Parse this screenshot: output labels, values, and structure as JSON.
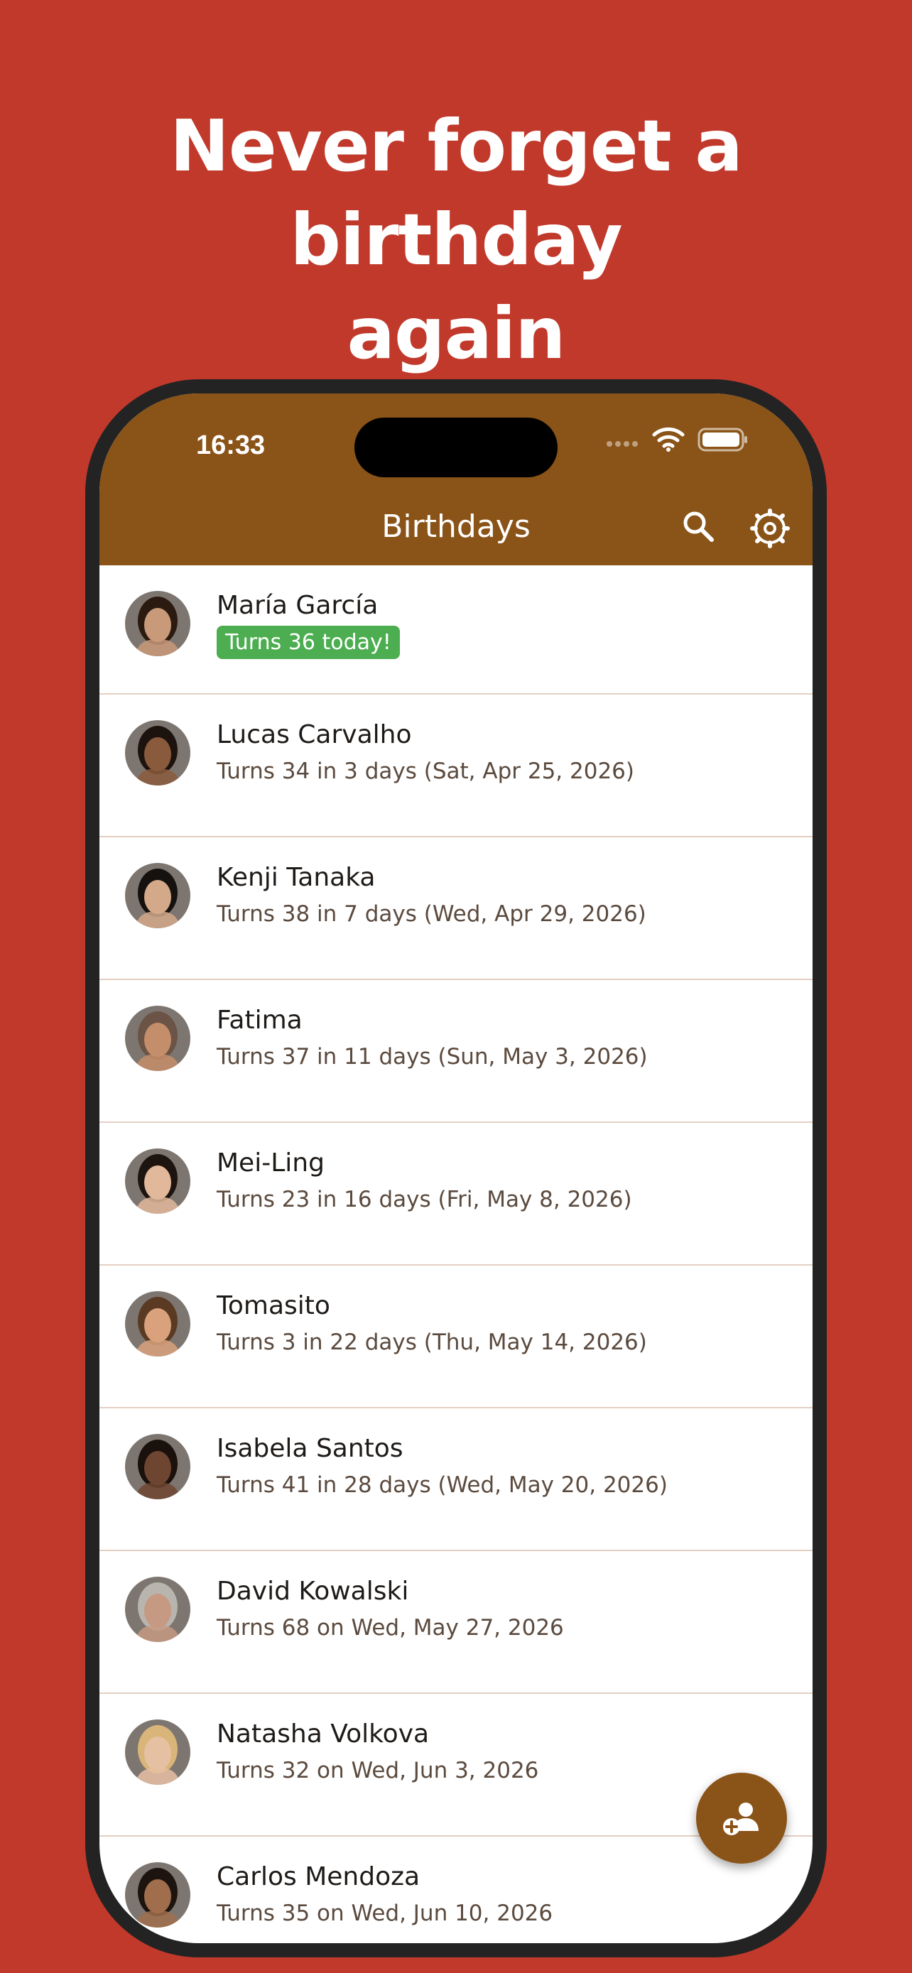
{
  "promo": {
    "headline_line1": "Never forget a birthday",
    "headline_line2": "again"
  },
  "status_bar": {
    "time": "16:33"
  },
  "app_bar": {
    "title": "Birthdays",
    "search_icon": "search-icon",
    "settings_icon": "settings-gear-icon"
  },
  "contacts": [
    {
      "name": "María García",
      "subtitle": "Turns 36 today!",
      "today": true,
      "skin": "#c99a7a",
      "hair": "#2a1a10"
    },
    {
      "name": "Lucas Carvalho",
      "subtitle": "Turns 34 in 3 days (Sat, Apr 25, 2026)",
      "skin": "#8a5a3c",
      "hair": "#1c130e"
    },
    {
      "name": "Kenji Tanaka",
      "subtitle": "Turns 38 in 7 days (Wed, Apr 29, 2026)",
      "skin": "#d4a98a",
      "hair": "#15110e"
    },
    {
      "name": "Fatima",
      "subtitle": "Turns 37 in 11 days (Sun, May 3, 2026)",
      "skin": "#c48e6a",
      "hair": "#6b5346"
    },
    {
      "name": "Mei-Ling",
      "subtitle": "Turns 23 in 16 days (Fri, May 8, 2026)",
      "skin": "#e2b89a",
      "hair": "#1d1410"
    },
    {
      "name": "Tomasito",
      "subtitle": "Turns 3 in 22 days (Thu, May 14, 2026)",
      "skin": "#d9a27c",
      "hair": "#5a3a22"
    },
    {
      "name": "Isabela Santos",
      "subtitle": "Turns 41 in 28 days (Wed, May 20, 2026)",
      "skin": "#6e4530",
      "hair": "#1a110c"
    },
    {
      "name": "David Kowalski",
      "subtitle": "Turns 68 on Wed, May 27, 2026",
      "skin": "#c69a82",
      "hair": "#b8b4ae"
    },
    {
      "name": "Natasha Volkova",
      "subtitle": "Turns 32 on Wed, Jun 3, 2026",
      "skin": "#e6c0a2",
      "hair": "#d9b57a"
    },
    {
      "name": "Carlos Mendoza",
      "subtitle": "Turns 35 on Wed, Jun 10, 2026",
      "skin": "#a06e4c",
      "hair": "#1d140f"
    }
  ],
  "fab": {
    "icon": "add-person-icon"
  },
  "colors": {
    "background": "#c1392b",
    "app_bar": "#8a5317",
    "badge": "#4cae50"
  }
}
